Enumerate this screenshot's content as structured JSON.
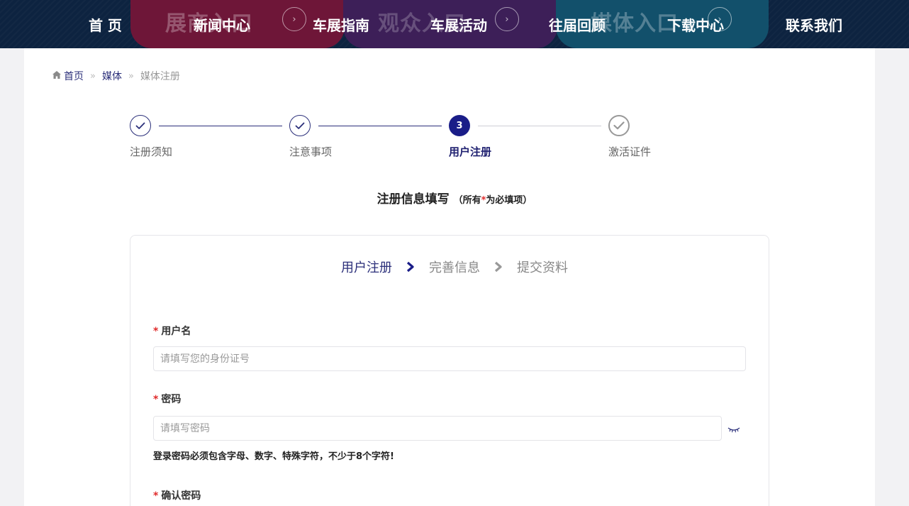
{
  "nav": {
    "items": [
      "首 页",
      "新闻中心",
      "车展指南",
      "车展活动",
      "往届回顾",
      "下载中心",
      "联系我们"
    ],
    "panels": [
      {
        "ghost": "展商入口",
        "color": "#6e1638",
        "icon": "chevron-right-circle-icon"
      },
      {
        "ghost": "观众入口",
        "color": "#3d1f58",
        "icon": "chevron-right-circle-icon"
      },
      {
        "ghost": "媒体入口",
        "color": "#12506b",
        "icon": "chevron-right-circle-icon"
      }
    ],
    "background": "#0d2340"
  },
  "breadcrumb": {
    "icon": "home-icon",
    "items": [
      "首页",
      "媒体"
    ],
    "current": "媒体注册",
    "separator": "»"
  },
  "steps": [
    {
      "label": "注册须知",
      "state": "done"
    },
    {
      "label": "注意事项",
      "state": "done"
    },
    {
      "label": "用户注册",
      "state": "active",
      "number": "3"
    },
    {
      "label": "激活证件",
      "state": "todo"
    }
  ],
  "form": {
    "heading": "注册信息填写",
    "note_prefix": "（所有",
    "note_star": "*",
    "note_suffix": "为必填项）",
    "substeps": [
      {
        "label": "用户注册",
        "active": true
      },
      {
        "label": "完善信息",
        "active": false
      },
      {
        "label": "提交资料",
        "active": false
      }
    ],
    "fields": [
      {
        "label": "用户名",
        "required": "*",
        "placeholder": "请填写您的身份证号",
        "value": ""
      },
      {
        "label": "密码",
        "required": "*",
        "placeholder": "请填写密码",
        "value": ""
      },
      {
        "label": "确认密码",
        "required": "*",
        "placeholder": "",
        "value": ""
      }
    ],
    "password_hint": "登录密码必须包含字母、数字、特殊字符，不少于8个字符!",
    "eye_icon": "eye-closed-icon"
  },
  "colors": {
    "accent": "#2b2f7a",
    "active_step": "#1a1d88",
    "required": "#e02b2b"
  }
}
